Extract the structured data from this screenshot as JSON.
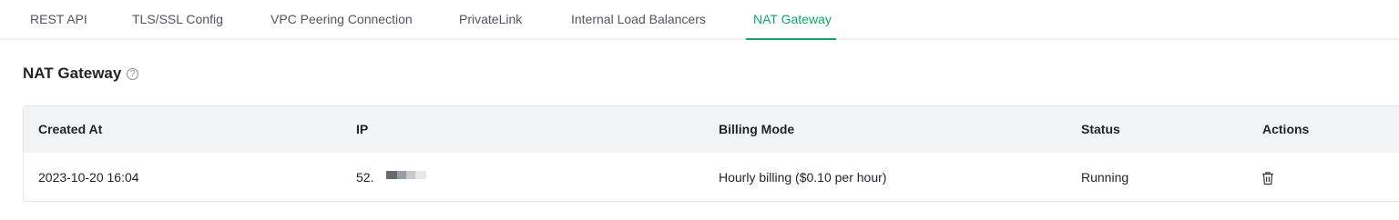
{
  "tabs": [
    {
      "label": "REST API",
      "active": false
    },
    {
      "label": "TLS/SSL Config",
      "active": false
    },
    {
      "label": "VPC Peering Connection",
      "active": false
    },
    {
      "label": "PrivateLink",
      "active": false
    },
    {
      "label": "Internal Load Balancers",
      "active": false
    },
    {
      "label": "NAT Gateway",
      "active": true
    }
  ],
  "section": {
    "title": "NAT Gateway",
    "help_icon": "question-circle-icon"
  },
  "table": {
    "columns": [
      "Created At",
      "IP",
      "Billing Mode",
      "Status",
      "Actions"
    ],
    "rows": [
      {
        "created_at": "2023-10-20 16:04",
        "ip": "52.",
        "billing_mode": "Hourly billing ($0.10 per hour)",
        "status": "Running",
        "action_icon": "trash-icon"
      }
    ]
  },
  "colors": {
    "accent": "#16a368",
    "tab_text": "#51565d",
    "header_bg": "#f2f3f5",
    "border": "#e4e6e9"
  }
}
